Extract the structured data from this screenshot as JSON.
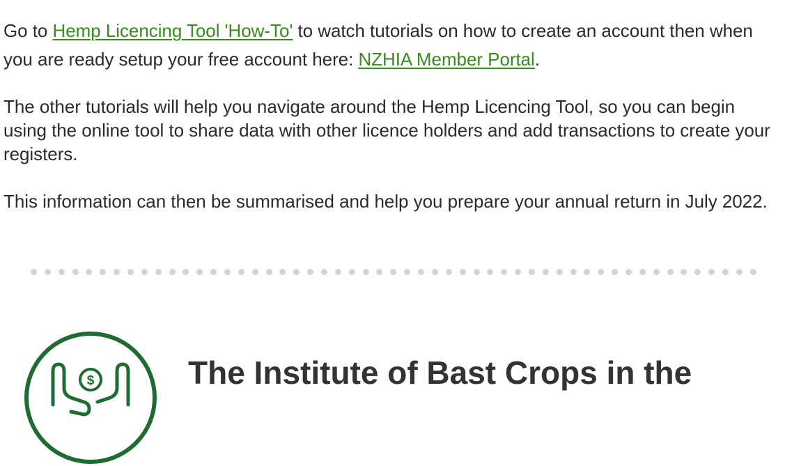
{
  "intro": {
    "text_before_link1": "Go to ",
    "link1_label": "Hemp Licencing Tool 'How-To'",
    "text_after_link1": " to watch tutorials on how to create an account then when you are ready setup your free account here: ",
    "link2_label": "NZHIA Member Portal",
    "text_after_link2": "."
  },
  "paragraph2": "The other tutorials will help you navigate around the Hemp Licencing Tool, so you can begin using the online tool to share data with other licence holders and add transactions to create your registers.",
  "paragraph3": "This information can then be summarised and help you prepare your annual return in July 2022.",
  "divider": {
    "dot_count": 53,
    "color": "#d3d3d3"
  },
  "footer": {
    "logo_icon": "hands-holding-dollar-coin-icon",
    "logo_color": "#1f6b34",
    "heading": "The Institute of Bast Crops in the"
  },
  "colors": {
    "text": "#2b2b2b",
    "link": "#3a8a1f",
    "heading": "#333333"
  }
}
